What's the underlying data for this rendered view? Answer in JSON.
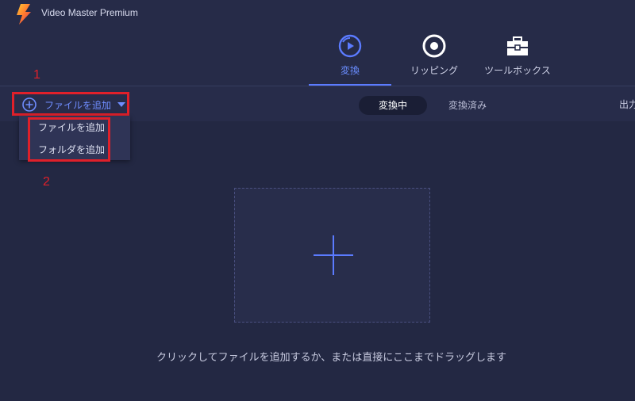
{
  "app": {
    "title": "Video Master Premium"
  },
  "nav": {
    "tabs": [
      {
        "label": "変換",
        "icon": "convert-play-icon",
        "active": true
      },
      {
        "label": "リッピング",
        "icon": "disc-icon",
        "active": false
      },
      {
        "label": "ツールボックス",
        "icon": "toolbox-icon",
        "active": false
      }
    ]
  },
  "toolbar": {
    "add_file_label": "ファイルを追加",
    "segments": [
      {
        "label": "変換中",
        "active": true
      },
      {
        "label": "変換済み",
        "active": false
      }
    ],
    "output_label": "出力"
  },
  "dropdown": {
    "items": [
      {
        "label": "ファイルを追加"
      },
      {
        "label": "フォルダを追加"
      }
    ]
  },
  "annotations": {
    "first": "1",
    "second": "2"
  },
  "dropzone": {
    "hint": "クリックしてファイルを追加するか、または直接にここまでドラッグします"
  },
  "colors": {
    "accent": "#5b7bff",
    "annotation": "#e0202a",
    "background": "#232843"
  }
}
